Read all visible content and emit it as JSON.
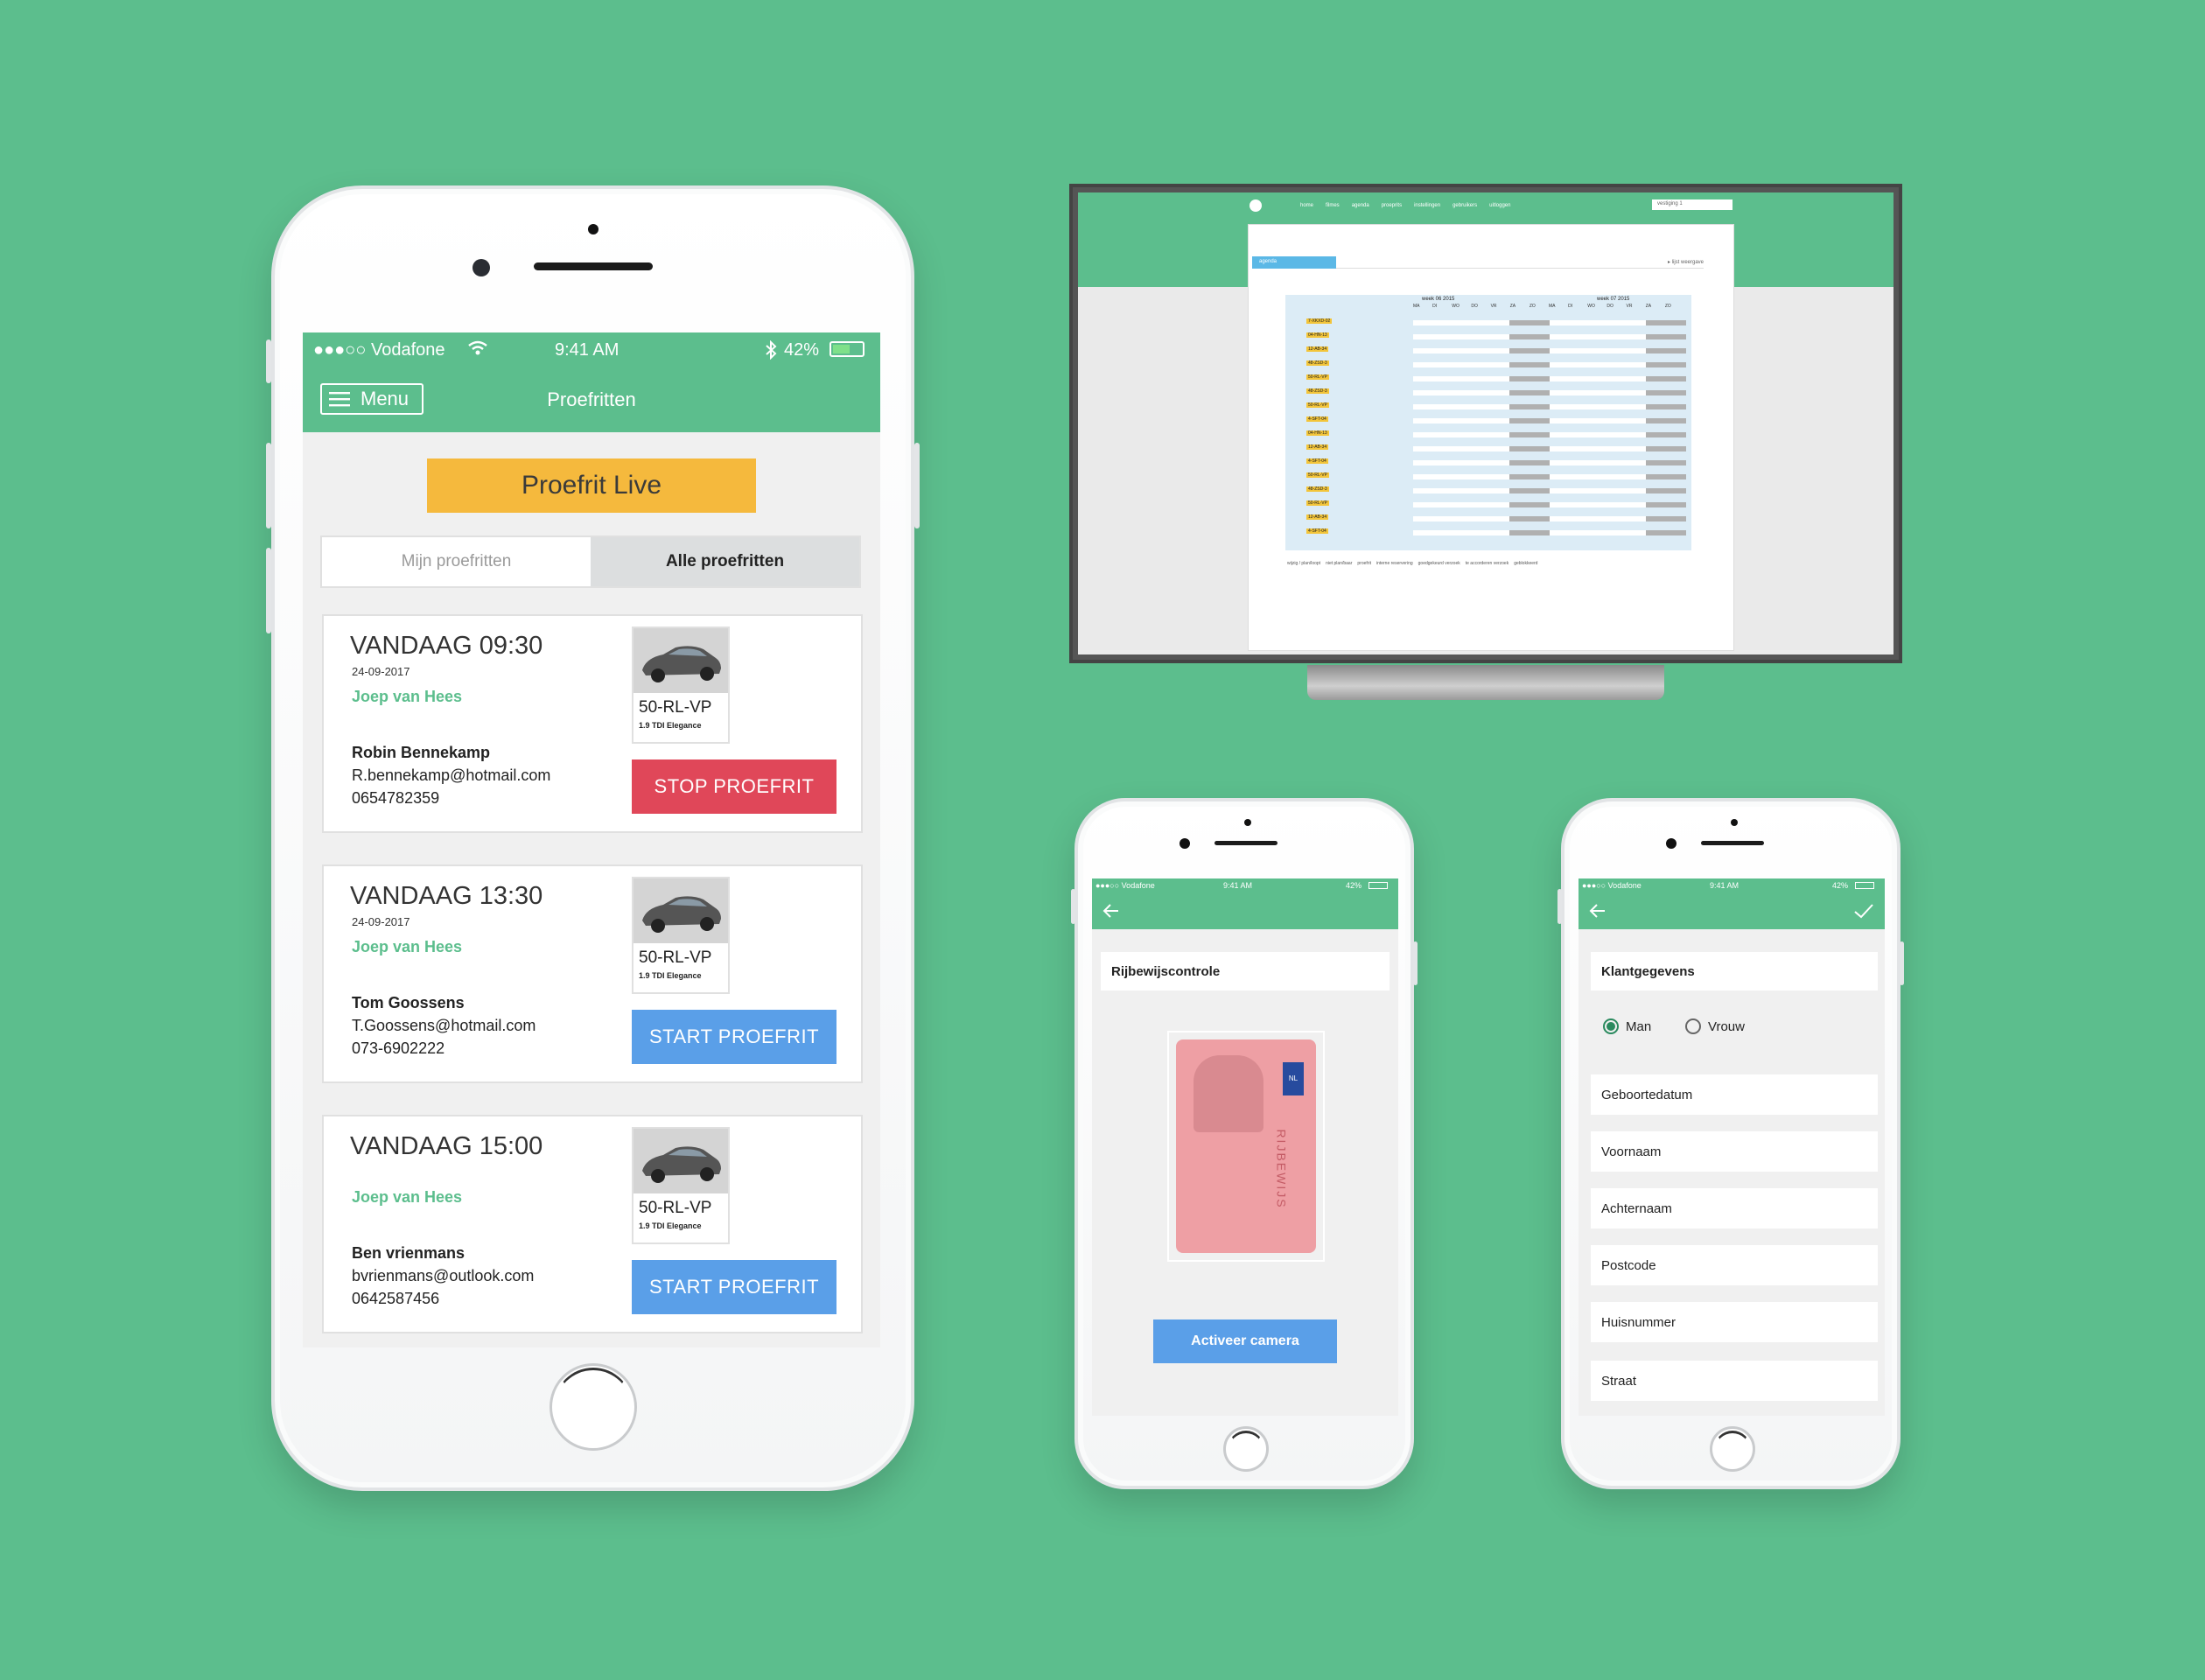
{
  "main_phone": {
    "status": {
      "carrier": "●●●○○ Vodafone",
      "time": "9:41 AM",
      "battery": "42%"
    },
    "nav": {
      "menu_label": "Menu",
      "title": "Proefritten"
    },
    "live_button": "Proefrit Live",
    "tabs": [
      {
        "label": "Mijn proefritten",
        "active": false
      },
      {
        "label": "Alle proefritten",
        "active": true
      }
    ],
    "cards": [
      {
        "time": "VANDAAG 09:30",
        "date": "24-09-2017",
        "agent": "Joep van Hees",
        "customer": "Robin Bennekamp",
        "email": "R.bennekamp@hotmail.com",
        "phone": "0654782359",
        "plate": "50-RL-VP",
        "model": "1.9 TDI Elegance",
        "action": "STOP PROEFRIT",
        "action_color": "#e04759"
      },
      {
        "time": "VANDAAG 13:30",
        "date": "24-09-2017",
        "agent": "Joep van Hees",
        "customer": "Tom Goossens",
        "email": "T.Goossens@hotmail.com",
        "phone": "073-6902222",
        "plate": "50-RL-VP",
        "model": "1.9 TDI Elegance",
        "action": "START PROEFRIT",
        "action_color": "#5a9fe8"
      },
      {
        "time": "VANDAAG 15:00",
        "date": "",
        "agent": "Joep van Hees",
        "customer": "Ben vrienmans",
        "email": "bvrienmans@outlook.com",
        "phone": "0642587456",
        "plate": "50-RL-VP",
        "model": "1.9 TDI Elegance",
        "action": "START PROEFRIT",
        "action_color": "#5a9fe8"
      }
    ]
  },
  "phone_license": {
    "status": {
      "carrier": "●●●○○ Vodafone",
      "time": "9:41 AM",
      "battery": "42%"
    },
    "section_title": "Rijbewijscontrole",
    "button": "Activeer camera",
    "card_text": "RIJBEWIJS",
    "card_country": "NL"
  },
  "phone_customer": {
    "status": {
      "carrier": "●●●○○ Vodafone",
      "time": "9:41 AM",
      "battery": "42%"
    },
    "section_title": "Klantgegevens",
    "gender_options": [
      {
        "label": "Man",
        "selected": true
      },
      {
        "label": "Vrouw",
        "selected": false
      }
    ],
    "fields": [
      "Geboortedatum",
      "Voornaam",
      "Achternaam",
      "Postcode",
      "Huisnummer",
      "Straat"
    ]
  },
  "desktop": {
    "nav_items": [
      "home",
      "filmes",
      "agenda",
      "proeprits",
      "instellingen",
      "gebruikers",
      "uitloggen"
    ],
    "location_select": "vestiging 1",
    "tab_label": "agenda",
    "view_toggle": "▸ lijst weergave",
    "weeks": [
      "week 06 2015",
      "week 07 2015"
    ],
    "days": [
      "MA",
      "DI",
      "WO",
      "DO",
      "VR",
      "ZA",
      "ZO",
      "MA",
      "DI",
      "WO",
      "DO",
      "VR",
      "ZA",
      "ZO"
    ],
    "plates": [
      "7-XKXD-02",
      "04-HN-13",
      "12-AB-34",
      "48-ZSD-3",
      "50-RL-VP",
      "48-ZSD-3",
      "50-RL-VP",
      "4-SFT-04",
      "04-HN-13",
      "12-AB-34",
      "4-SFT-04",
      "50-RL-VP",
      "48-ZSD-3",
      "50-RL-VP",
      "12-AB-34",
      "4-SFT-04"
    ],
    "legend": [
      "wijzig / plan/loopt",
      "niet plan/baar",
      "proefrit",
      "interne reservering",
      "goedgekeurd verzoek",
      "te accorderen verzoek",
      "geblokkeerd"
    ]
  }
}
